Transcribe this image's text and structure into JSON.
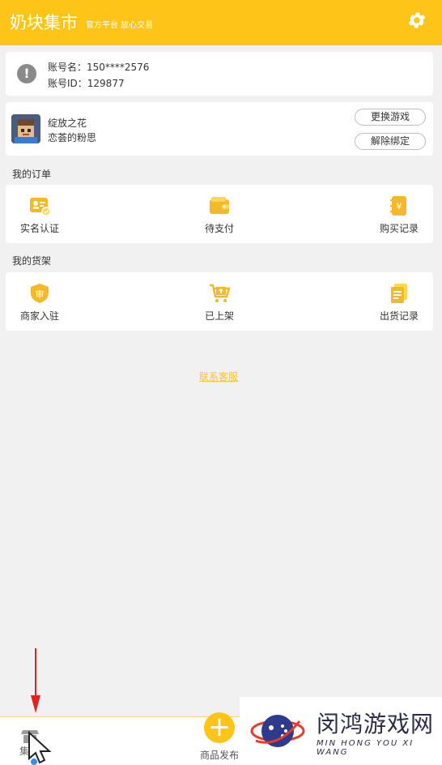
{
  "header": {
    "title": "奶块集市",
    "slogan": "官方平台 放心交易",
    "settings_icon": "gear-icon"
  },
  "account": {
    "name_label": "账号名：150****2576",
    "id_label": "账号ID：129877"
  },
  "game": {
    "name": "绽放之花",
    "subtitle": "恋荟的粉思",
    "change_label": "更换游戏",
    "unbind_label": "解除绑定"
  },
  "orders": {
    "title": "我的订单",
    "items": [
      {
        "label": "实名认证",
        "icon": "id-card-icon"
      },
      {
        "label": "待支付",
        "icon": "wallet-icon"
      },
      {
        "label": "购买记录",
        "icon": "yen-record-icon"
      }
    ]
  },
  "shelf": {
    "title": "我的货架",
    "items": [
      {
        "label": "商家入驻",
        "icon": "merchant-badge-icon"
      },
      {
        "label": "已上架",
        "icon": "cart-upload-icon"
      },
      {
        "label": "出货记录",
        "icon": "shipment-record-icon"
      }
    ]
  },
  "service_link": "联系客服",
  "tabbar": {
    "market_label": "集",
    "publish_label": "商品发布"
  },
  "watermark": {
    "cn": "闵鸿游戏网",
    "en": "MIN HONG YOU XI WANG"
  },
  "colors": {
    "brand": "#fec518",
    "link": "#f6c23a",
    "background": "#f1f1f1"
  }
}
